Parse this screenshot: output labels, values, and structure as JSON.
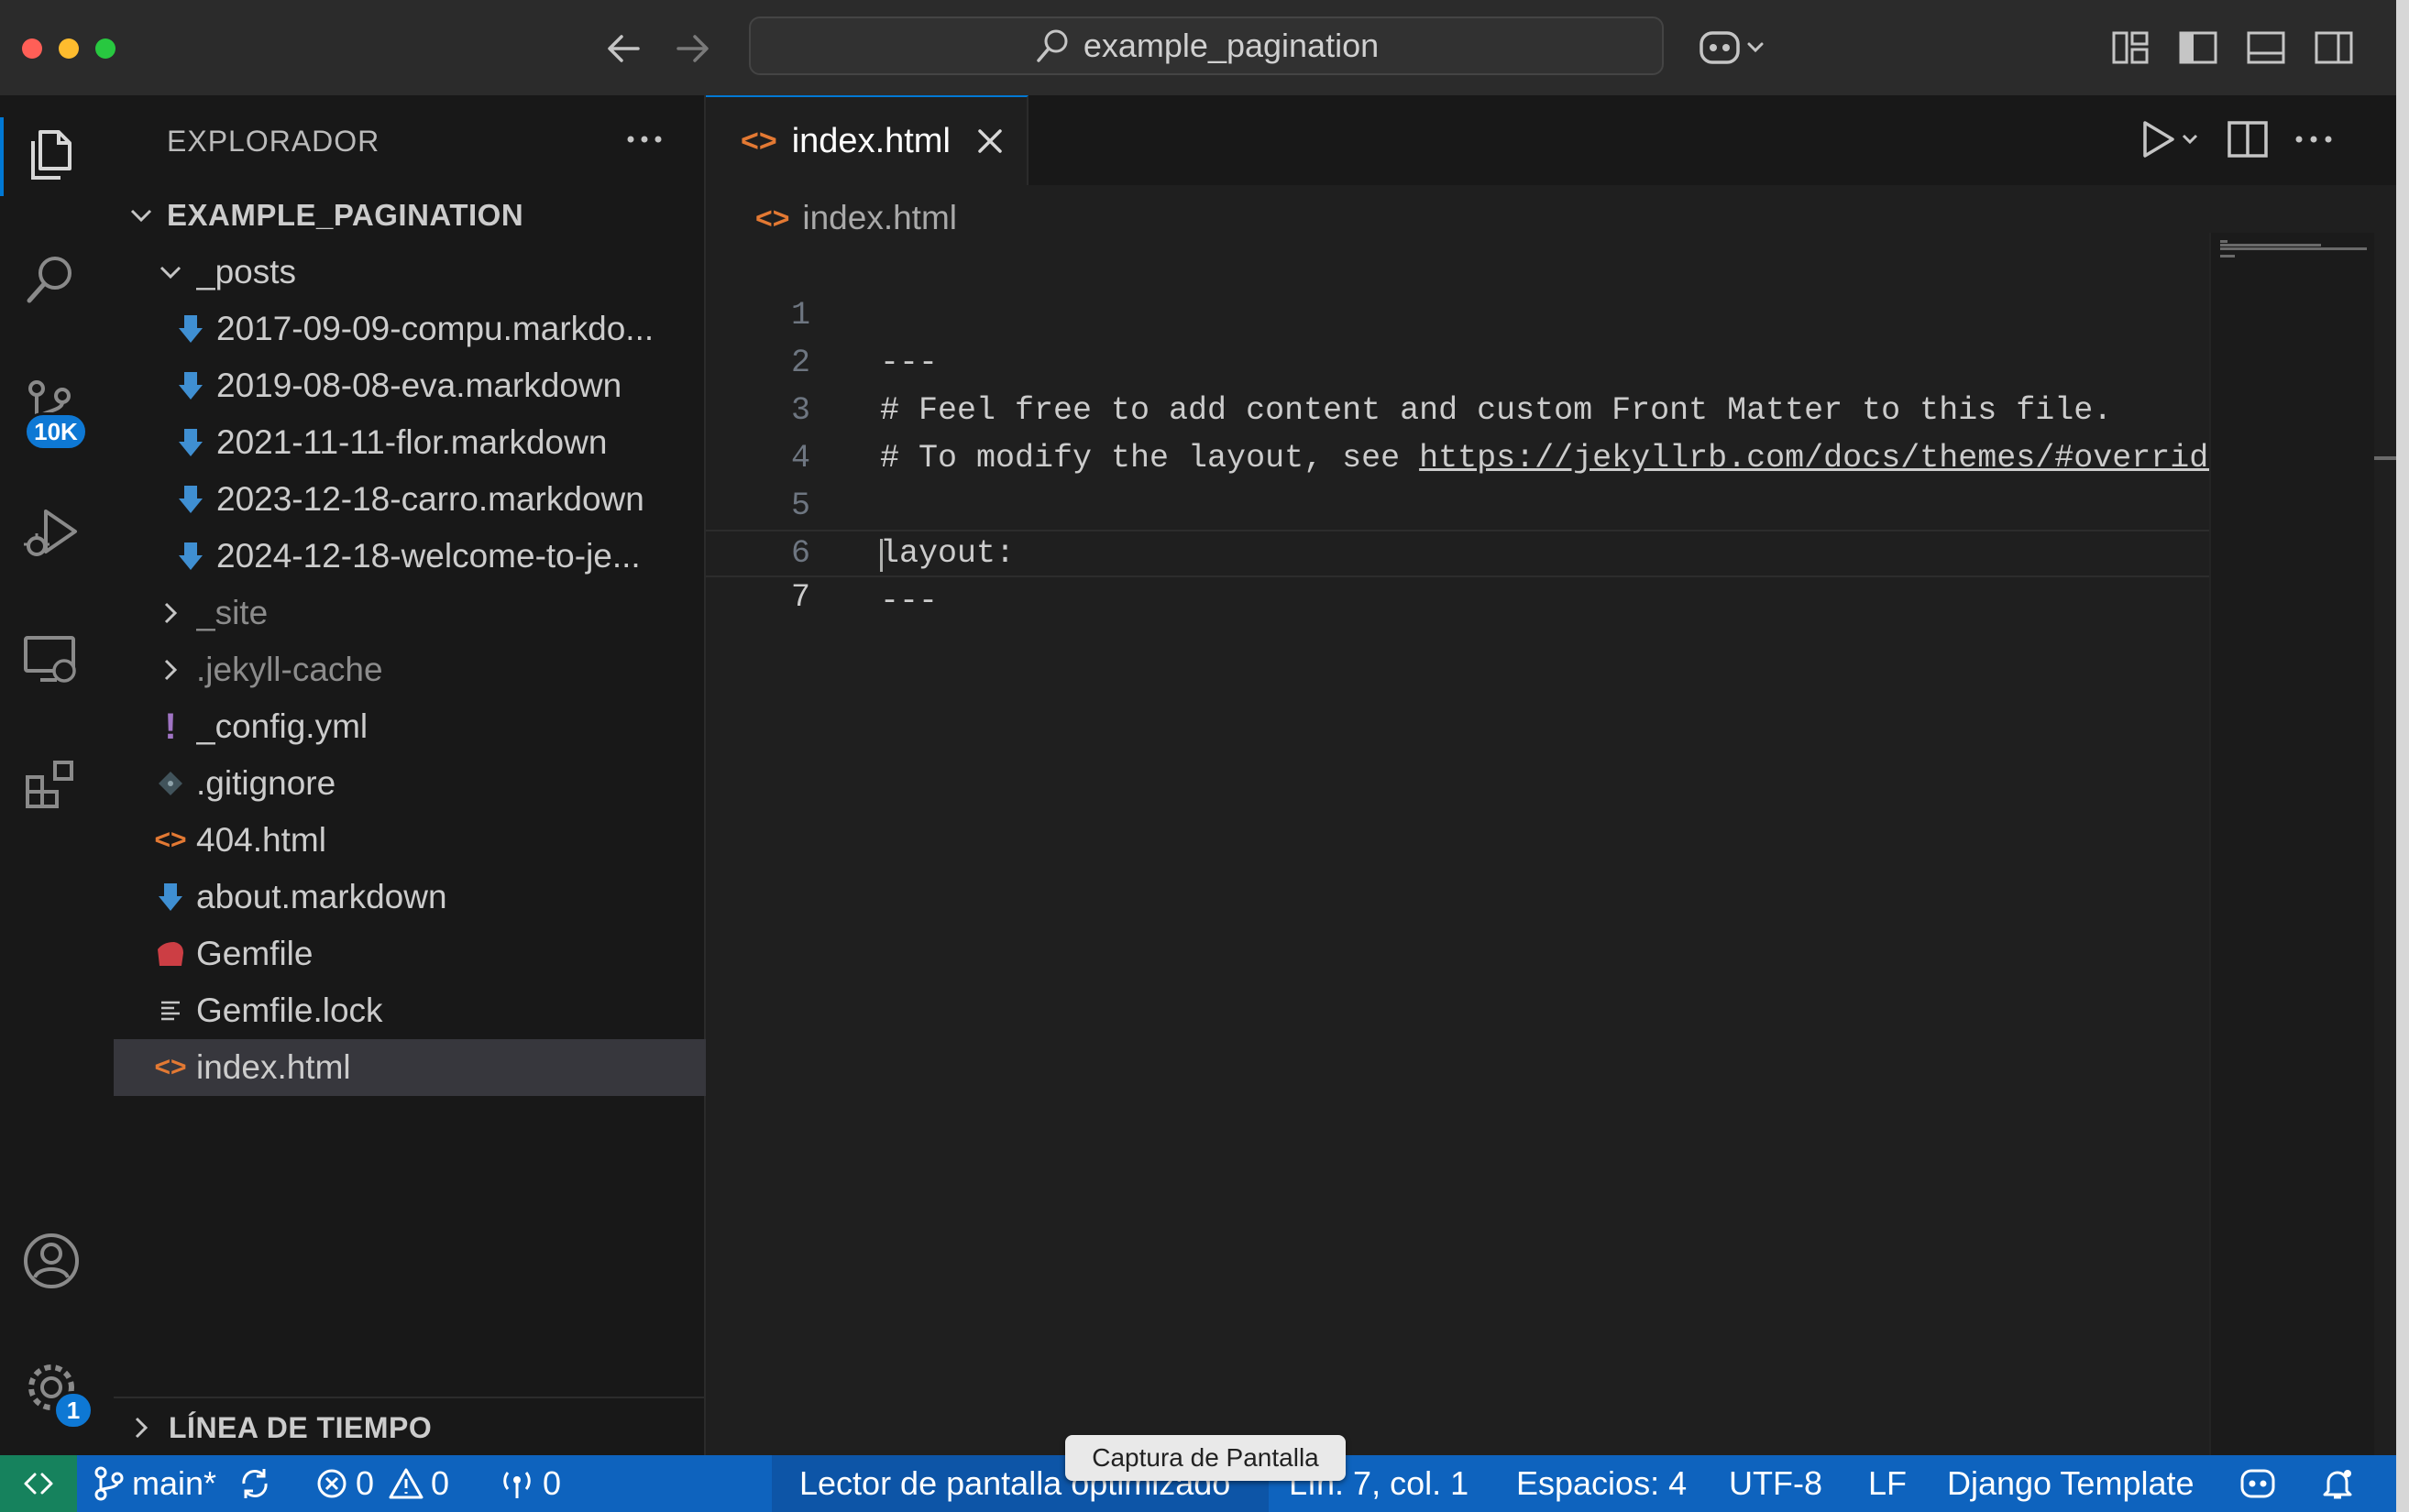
{
  "titlebar": {
    "search_text": "example_pagination"
  },
  "activity": {
    "scm_badge": "10K",
    "settings_badge": "1"
  },
  "sidebar": {
    "title": "EXPLORADOR",
    "root": "EXAMPLE_PAGINATION",
    "items": [
      {
        "label": "_posts",
        "icon": "folder-open"
      },
      {
        "label": "2017-09-09-compu.markdo...",
        "icon": "markdown-icon"
      },
      {
        "label": "2019-08-08-eva.markdown",
        "icon": "markdown-icon"
      },
      {
        "label": "2021-11-11-flor.markdown",
        "icon": "markdown-icon"
      },
      {
        "label": "2023-12-18-carro.markdown",
        "icon": "markdown-icon"
      },
      {
        "label": "2024-12-18-welcome-to-je...",
        "icon": "markdown-icon"
      },
      {
        "label": "_site",
        "icon": "folder-closed"
      },
      {
        "label": ".jekyll-cache",
        "icon": "folder-closed"
      },
      {
        "label": "_config.yml",
        "icon": "yaml-icon"
      },
      {
        "label": ".gitignore",
        "icon": "git-icon"
      },
      {
        "label": "404.html",
        "icon": "html-icon"
      },
      {
        "label": "about.markdown",
        "icon": "markdown-icon"
      },
      {
        "label": "Gemfile",
        "icon": "ruby-icon"
      },
      {
        "label": "Gemfile.lock",
        "icon": "lines-icon"
      },
      {
        "label": "index.html",
        "icon": "html-icon"
      }
    ],
    "timeline": "LÍNEA DE TIEMPO"
  },
  "editor": {
    "tab_label": "index.html",
    "breadcrumb": "index.html",
    "lines": [
      {
        "n": "1",
        "text": "---"
      },
      {
        "n": "2",
        "text": "# Feel free to add content and custom Front Matter to this file."
      },
      {
        "n": "3",
        "text_pre": "# To modify the layout, see ",
        "link": "https://jekyllrb.com/docs/themes/#overridi"
      },
      {
        "n": "4",
        "text": ""
      },
      {
        "n": "5",
        "text": "layout:"
      },
      {
        "n": "6",
        "text": "---"
      },
      {
        "n": "7",
        "text": ""
      }
    ]
  },
  "statusbar": {
    "branch": "main*",
    "errors": "0",
    "warnings": "0",
    "ports": "0",
    "screen_reader": "Lector de pantalla optimizado",
    "position": "Lín. 7, col. 1",
    "spaces": "Espacios: 4",
    "encoding": "UTF-8",
    "eol": "LF",
    "language": "Django Template"
  },
  "tooltip": "Captura de Pantalla"
}
